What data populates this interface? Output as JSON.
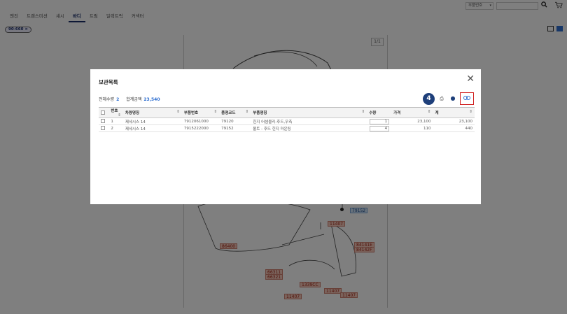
{
  "nav": {
    "tabs": [
      "엔진",
      "트랜스미션",
      "섀시",
      "바디",
      "트림",
      "일렉트릭",
      "커넥터"
    ],
    "active_tab_index": 3,
    "search_type": "부품번호",
    "search_value": ""
  },
  "filter_chip": "90-660 ×",
  "diagram": {
    "page_indicator": "1/1",
    "callouts": [
      "79152",
      "11407",
      "86400",
      "84141E",
      "84142F",
      "66311",
      "66321",
      "1339CC",
      "11407",
      "11407",
      "11407"
    ]
  },
  "modal": {
    "title": "보관목록",
    "summary": {
      "total_qty_label": "전체수량",
      "total_qty": "2",
      "total_amount_label": "합계금액",
      "total_amount": "23,540"
    },
    "step_badge": "4",
    "columns": [
      "번호",
      "차량명칭",
      "부품번호",
      "품명코드",
      "부품명칭",
      "수량",
      "가격",
      "계"
    ],
    "rows": [
      {
        "no": "1",
        "vehicle": "제네시스 14",
        "part_no": "7912061000",
        "code": "79120",
        "name": "힌지 어셈블리-후드,우측",
        "qty": "1",
        "price": "23,100",
        "total": "23,100"
      },
      {
        "no": "2",
        "vehicle": "제네시스 14",
        "part_no": "7915222000",
        "code": "79152",
        "name": "볼트 - 후드 힌지 마운팅",
        "qty": "4",
        "price": "110",
        "total": "440"
      }
    ]
  },
  "colors": {
    "accent": "#2f6fd0",
    "navy": "#1e3f7a",
    "highlight_border": "#d01c1c"
  }
}
